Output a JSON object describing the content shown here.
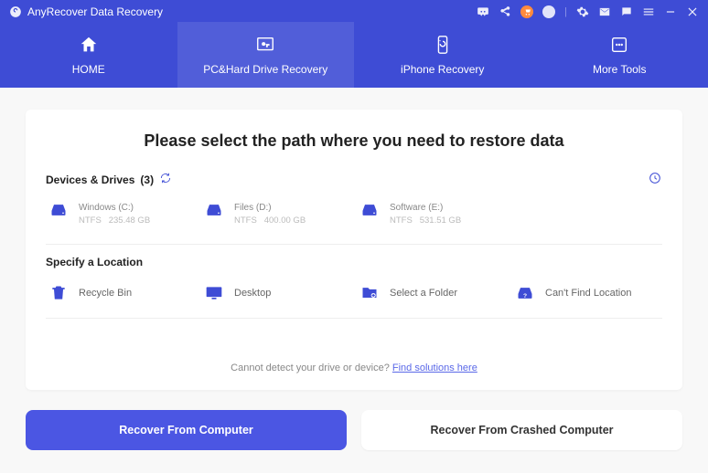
{
  "titlebar": {
    "app_name": "AnyRecover Data Recovery",
    "cart_badge": "•"
  },
  "nav": {
    "items": [
      {
        "label": "HOME"
      },
      {
        "label": "PC&Hard Drive Recovery"
      },
      {
        "label": "iPhone Recovery"
      },
      {
        "label": "More Tools"
      }
    ],
    "active_index": 1
  },
  "main": {
    "heading": "Please select the path where you need to restore data",
    "devices_label": "Devices & Drives",
    "devices_count": "(3)",
    "drives": [
      {
        "name": "Windows (C:)",
        "fs": "NTFS",
        "size": "235.48 GB"
      },
      {
        "name": "Files (D:)",
        "fs": "NTFS",
        "size": "400.00 GB"
      },
      {
        "name": "Software (E:)",
        "fs": "NTFS",
        "size": "531.51 GB"
      }
    ],
    "specify_label": "Specify a Location",
    "locations": [
      {
        "label": "Recycle Bin"
      },
      {
        "label": "Desktop"
      },
      {
        "label": "Select a Folder"
      },
      {
        "label": "Can't Find Location"
      }
    ],
    "detect_text": "Cannot detect your drive or device? ",
    "detect_link": "Find solutions here"
  },
  "actions": {
    "primary": "Recover From Computer",
    "secondary": "Recover From Crashed Computer"
  }
}
